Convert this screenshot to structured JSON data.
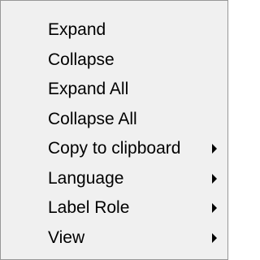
{
  "context_menu": {
    "items": [
      {
        "label": "Expand",
        "has_submenu": false
      },
      {
        "label": "Collapse",
        "has_submenu": false
      },
      {
        "label": "Expand All",
        "has_submenu": false
      },
      {
        "label": "Collapse All",
        "has_submenu": false
      },
      {
        "label": "Copy to clipboard",
        "has_submenu": true,
        "arrow_icon": "submenu-arrow-icon"
      },
      {
        "label": "Language",
        "has_submenu": true,
        "arrow_icon": "submenu-arrow-icon"
      },
      {
        "label": "Label Role",
        "has_submenu": true,
        "arrow_icon": "submenu-arrow-icon"
      },
      {
        "label": "View",
        "has_submenu": true,
        "arrow_icon": "submenu-arrow-icon"
      }
    ],
    "colors": {
      "background": "#f0f0f0",
      "border": "#979797",
      "text": "#000000"
    }
  }
}
